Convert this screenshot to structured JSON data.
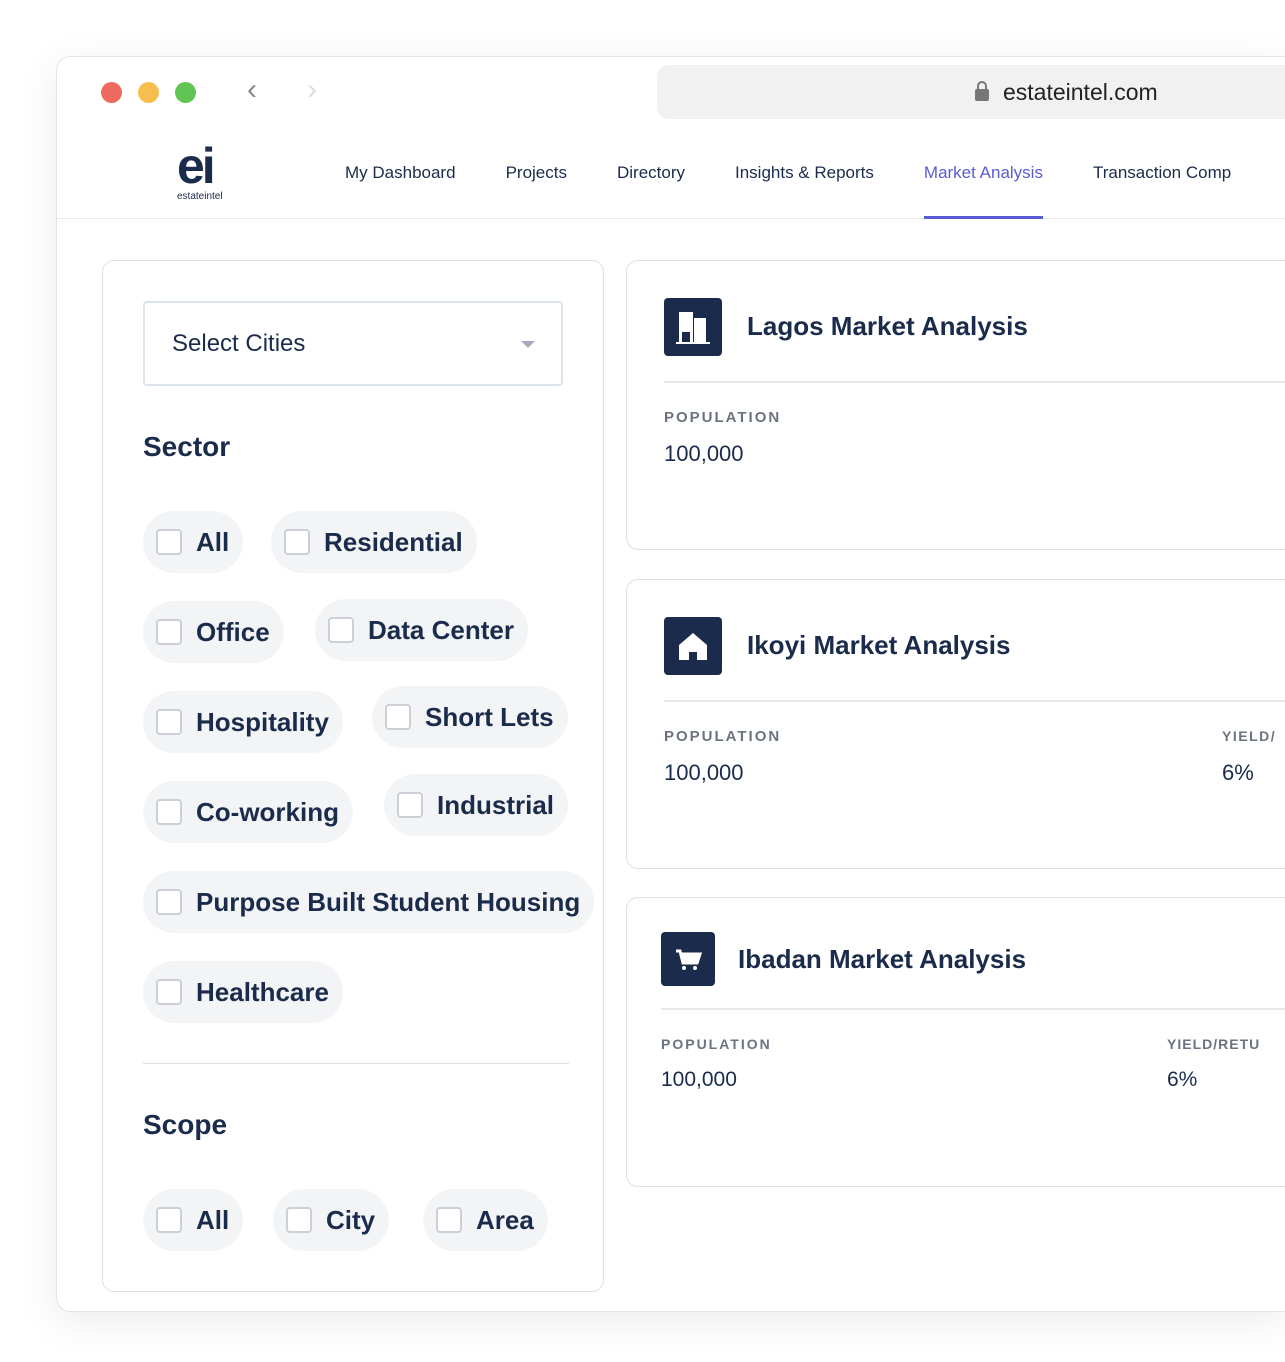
{
  "browser": {
    "url": "estateintel.com"
  },
  "logo": {
    "mark": "ei",
    "text": "estateintel"
  },
  "nav": {
    "items": [
      {
        "label": "My Dashboard"
      },
      {
        "label": "Projects"
      },
      {
        "label": "Directory"
      },
      {
        "label": "Insights & Reports"
      },
      {
        "label": "Market Analysis",
        "active": true
      },
      {
        "label": "Transaction Comp"
      }
    ]
  },
  "filters": {
    "select_cities": "Select Cities",
    "sector_title": "Sector",
    "sectors": [
      "All",
      "Residential",
      "Office",
      "Data Center",
      "Hospitality",
      "Short Lets",
      "Co-working",
      "Industrial",
      "Purpose Built Student Housing",
      "Healthcare"
    ],
    "scope_title": "Scope",
    "scopes": [
      "All",
      "City",
      "Area"
    ]
  },
  "cards": [
    {
      "title": "Lagos Market Analysis",
      "icon": "building-icon",
      "population_label": "POPULATION",
      "population": "100,000"
    },
    {
      "title": "Ikoyi Market Analysis",
      "icon": "house-icon",
      "population_label": "POPULATION",
      "population": "100,000",
      "yield_label": "YIELD/",
      "yield": "6%"
    },
    {
      "title": "Ibadan Market Analysis",
      "icon": "cart-icon",
      "population_label": "POPULATION",
      "population": "100,000",
      "yield_label": "YIELD/RETU",
      "yield": "6%"
    }
  ],
  "colors": {
    "accent": "#5b5bd6",
    "navy": "#1b2b4b"
  }
}
